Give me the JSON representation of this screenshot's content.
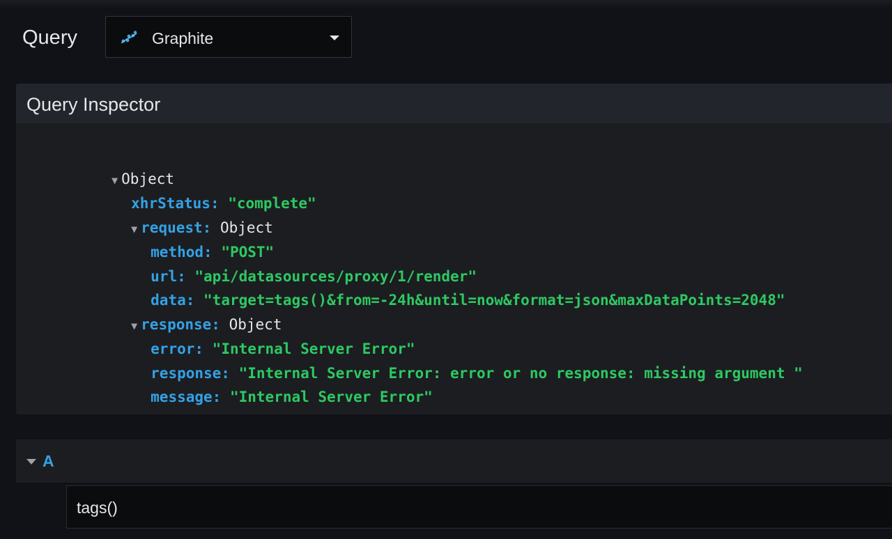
{
  "header": {
    "query_label": "Query",
    "datasource": {
      "name": "Graphite",
      "icon": "graphite-logo-icon"
    }
  },
  "inspector": {
    "title": "Query Inspector",
    "tree": {
      "root": "Object",
      "xhrStatus": {
        "key": "xhrStatus:",
        "value": "\"complete\""
      },
      "request": {
        "key": "request:",
        "type": "Object",
        "method": {
          "key": "method:",
          "value": "\"POST\""
        },
        "url": {
          "key": "url:",
          "value": "\"api/datasources/proxy/1/render\""
        },
        "data": {
          "key": "data:",
          "value": "\"target=tags()&from=-24h&until=now&format=json&maxDataPoints=2048\""
        }
      },
      "response": {
        "key": "response:",
        "type": "Object",
        "error": {
          "key": "error:",
          "value": "\"Internal Server Error\""
        },
        "response": {
          "key": "response:",
          "value": "\"Internal Server Error: error or no response: missing argument \""
        },
        "message": {
          "key": "message:",
          "value": "\"Internal Server Error\""
        }
      }
    }
  },
  "query_row": {
    "ref_id": "A",
    "query": "tags()"
  },
  "colors": {
    "background": "#111217",
    "panel": "#1c1d21",
    "key": "#33a2e5",
    "string": "#2dc962",
    "text": "#e6e7ea"
  }
}
